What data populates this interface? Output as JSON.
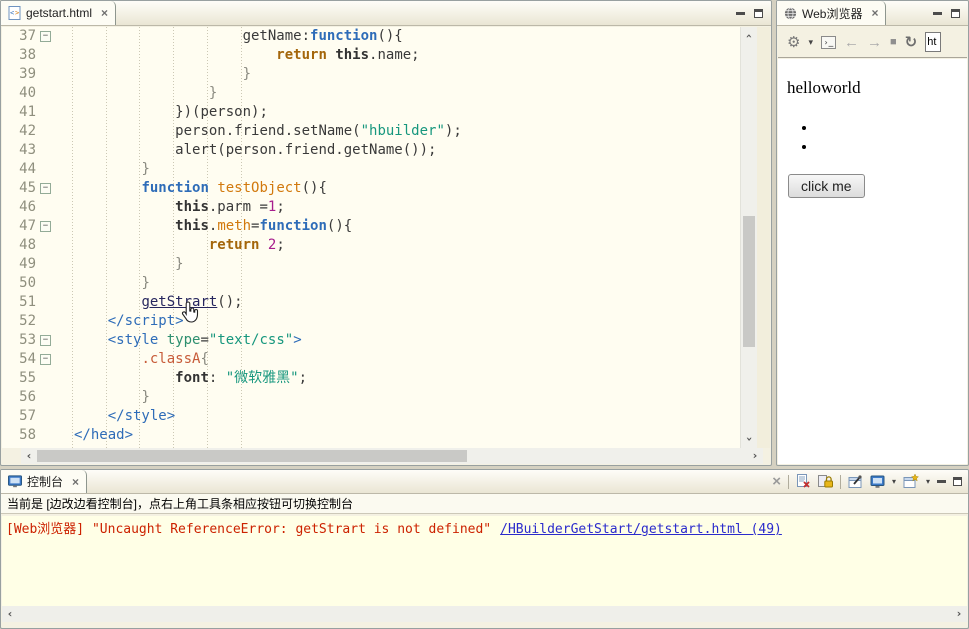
{
  "icons": {
    "close": "×",
    "clear_x": "×",
    "dropdown": "▾",
    "back_arrow": "←",
    "forward_arrow": "→",
    "stop": "■",
    "refresh": "↻",
    "gear": "⚙",
    "terminal": "›_",
    "fold_collapse": "−",
    "chevron": "›"
  },
  "editor": {
    "tab_label": "getstart.html",
    "lines": [
      {
        "n": 37,
        "ind": 5,
        "fold": true,
        "tk": [
          [
            "p",
            "getName:"
          ],
          [
            "k",
            "function"
          ],
          [
            "p",
            "(){"
          ]
        ]
      },
      {
        "n": 38,
        "ind": 6,
        "tk": [
          [
            "k2",
            "return"
          ],
          [
            "p",
            " "
          ],
          [
            "b",
            "this"
          ],
          [
            "p",
            ".name;"
          ]
        ]
      },
      {
        "n": 39,
        "ind": 5,
        "tk": [
          [
            "g",
            "}"
          ]
        ]
      },
      {
        "n": 40,
        "ind": 4,
        "tk": [
          [
            "g",
            "}"
          ]
        ]
      },
      {
        "n": 41,
        "ind": 3,
        "tk": [
          [
            "p",
            "})(person);"
          ]
        ]
      },
      {
        "n": 42,
        "ind": 3,
        "tk": [
          [
            "p",
            "person.friend.setName("
          ],
          [
            "s",
            "\"hbuilder\""
          ],
          [
            "p",
            ");"
          ]
        ]
      },
      {
        "n": 43,
        "ind": 3,
        "tk": [
          [
            "p",
            "alert(person.friend.getName());"
          ]
        ]
      },
      {
        "n": 44,
        "ind": 2,
        "tk": [
          [
            "g",
            "}"
          ]
        ]
      },
      {
        "n": 45,
        "ind": 2,
        "fold": true,
        "tk": [
          [
            "k",
            "function"
          ],
          [
            "p",
            " "
          ],
          [
            "fn",
            "testObject"
          ],
          [
            "p",
            "(){"
          ]
        ]
      },
      {
        "n": 46,
        "ind": 3,
        "tk": [
          [
            "b",
            "this"
          ],
          [
            "p",
            ".parm ="
          ],
          [
            "n",
            "1"
          ],
          [
            "p",
            ";"
          ]
        ]
      },
      {
        "n": 47,
        "ind": 3,
        "fold": true,
        "tk": [
          [
            "b",
            "this"
          ],
          [
            "p",
            "."
          ],
          [
            "fn",
            "meth"
          ],
          [
            "p",
            "="
          ],
          [
            "k",
            "function"
          ],
          [
            "p",
            "(){"
          ]
        ]
      },
      {
        "n": 48,
        "ind": 4,
        "tk": [
          [
            "k2",
            "return"
          ],
          [
            "p",
            " "
          ],
          [
            "n",
            "2"
          ],
          [
            "p",
            ";"
          ]
        ]
      },
      {
        "n": 49,
        "ind": 3,
        "tk": [
          [
            "g",
            "}"
          ]
        ]
      },
      {
        "n": 50,
        "ind": 2,
        "tk": [
          [
            "g",
            "}"
          ]
        ]
      },
      {
        "n": 51,
        "ind": 2,
        "tk": [
          [
            "l",
            "getStrart"
          ],
          [
            "p",
            "();"
          ]
        ]
      },
      {
        "n": 52,
        "ind": 1,
        "tk": [
          [
            "t",
            "</script>"
          ]
        ]
      },
      {
        "n": 53,
        "ind": 1,
        "fold": true,
        "tk": [
          [
            "t",
            "<style"
          ],
          [
            "p",
            " "
          ],
          [
            "a",
            "type"
          ],
          [
            "p",
            "="
          ],
          [
            "s",
            "\"text/css\""
          ],
          [
            "t",
            ">"
          ]
        ]
      },
      {
        "n": 54,
        "ind": 2,
        "fold": true,
        "tk": [
          [
            "c",
            ".classA"
          ],
          [
            "g",
            "{"
          ]
        ]
      },
      {
        "n": 55,
        "ind": 3,
        "tk": [
          [
            "b",
            "font"
          ],
          [
            "p",
            ": "
          ],
          [
            "s",
            "\"微软雅黑\""
          ],
          [
            "p",
            ";"
          ]
        ]
      },
      {
        "n": 56,
        "ind": 2,
        "tk": [
          [
            "g",
            "}"
          ]
        ]
      },
      {
        "n": 57,
        "ind": 1,
        "tk": [
          [
            "t",
            "</style>"
          ]
        ]
      },
      {
        "n": 58,
        "ind": 0,
        "tk": [
          [
            "t",
            "</head>"
          ]
        ]
      }
    ]
  },
  "browser": {
    "tab_label": "Web浏览器",
    "url_value": "ht",
    "content": {
      "heading": "helloworld",
      "list_items": [
        "",
        ""
      ],
      "button_label": "click me"
    }
  },
  "console": {
    "tab_label": "控制台",
    "status_text": "当前是 [边改边看控制台]，点右上角工具条相应按钮可切换控制台",
    "error_text": "[Web浏览器] \"Uncaught ReferenceError: getStrart is not defined\"",
    "error_link": "/HBuilderGetStart/getstart.html (49)"
  }
}
